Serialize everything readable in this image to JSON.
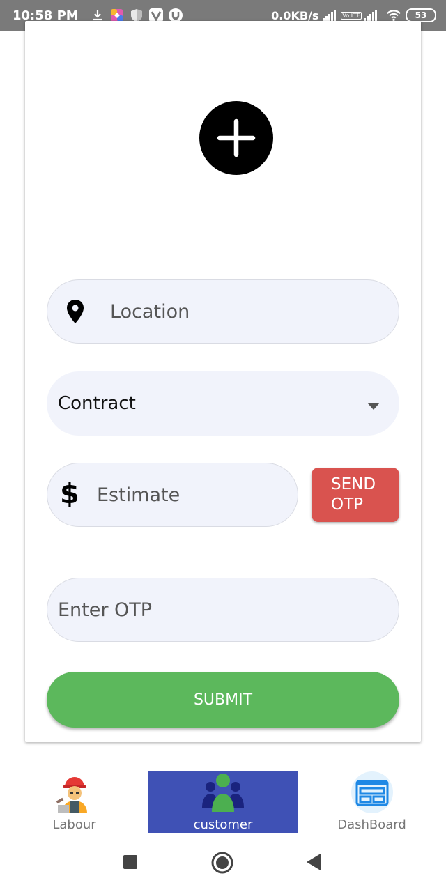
{
  "status_bar": {
    "time": "10:58 PM",
    "network_speed": "0.0KB/s",
    "battery": "53",
    "icons": [
      "download-icon",
      "app-icon",
      "shield-icon",
      "v-app-icon",
      "torrent-icon",
      "signal-icon",
      "volte-icon",
      "wifi-icon",
      "battery-icon"
    ],
    "volte_label": "Vo LTE"
  },
  "form": {
    "add_button_icon": "plus-icon",
    "location": {
      "placeholder": "Location",
      "icon": "location-pin-icon"
    },
    "contract": {
      "value": "Contract",
      "icon": "dropdown-arrow-icon"
    },
    "estimate": {
      "placeholder": "Estimate",
      "icon": "dollar-icon"
    },
    "send_otp_label": "SEND\nOTP",
    "otp": {
      "placeholder": "Enter OTP"
    },
    "submit_label": "SUBMIT"
  },
  "bottom_nav": {
    "items": [
      {
        "label": "Labour",
        "icon": "labour-worker-icon"
      },
      {
        "label": "customer",
        "icon": "customer-group-icon",
        "active": true
      },
      {
        "label": "DashBoard",
        "icon": "dashboard-icon"
      }
    ],
    "active_color": "#3f51b5"
  },
  "system_nav": {
    "icons": [
      "recent-apps-icon",
      "home-icon",
      "back-icon"
    ]
  },
  "colors": {
    "send_otp": "#d9534f",
    "submit": "#5cb85c",
    "input_bg": "#f1f3fb"
  }
}
